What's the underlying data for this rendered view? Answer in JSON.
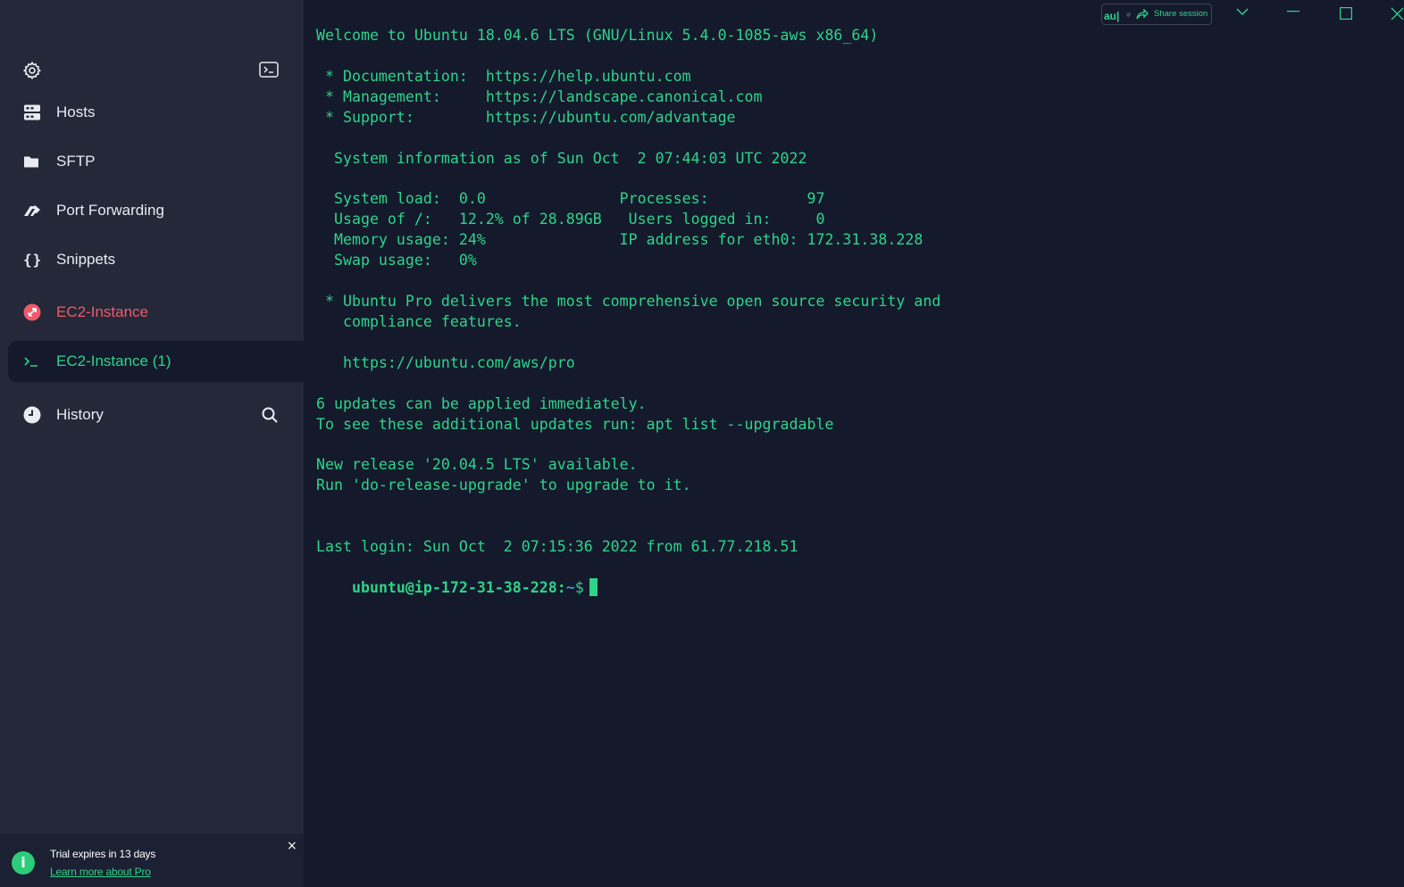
{
  "colors": {
    "accent_green": "#2fd38a",
    "danger_red": "#f0596a",
    "sidebar_bg": "#242838",
    "terminal_bg": "#141a2c",
    "path_blue": "#3c8fd6"
  },
  "sidebar": {
    "top_icons": [
      "gear-icon",
      "terminal-icon"
    ],
    "nav": [
      {
        "label": "Hosts",
        "icon": "server-icon"
      },
      {
        "label": "SFTP",
        "icon": "folder-icon"
      },
      {
        "label": "Port Forwarding",
        "icon": "port-forwarding-icon"
      },
      {
        "label": "Snippets",
        "icon": "braces-icon"
      },
      {
        "label": "EC2-Instance",
        "icon": "host-error-icon",
        "status": "error"
      },
      {
        "label": "EC2-Instance (1)",
        "icon": "prompt-icon",
        "active": true
      },
      {
        "label": "History",
        "icon": "clock-icon",
        "action_icon": "search-icon"
      }
    ],
    "trial": {
      "text": "Trial expires in 13 days",
      "link": "Learn more about Pro",
      "close": "×",
      "icon_text": "i"
    }
  },
  "header": {
    "badge": "au|",
    "share_label": "Share session",
    "icons": [
      "dot-icon",
      "share-arrow-icon",
      "chevron-down-icon",
      "minimize-icon",
      "maximize-icon",
      "close-icon"
    ]
  },
  "terminal": {
    "output": "Welcome to Ubuntu 18.04.6 LTS (GNU/Linux 5.4.0-1085-aws x86_64)\n\n * Documentation:  https://help.ubuntu.com\n * Management:     https://landscape.canonical.com\n * Support:        https://ubuntu.com/advantage\n\n  System information as of Sun Oct  2 07:44:03 UTC 2022\n\n  System load:  0.0               Processes:           97\n  Usage of /:   12.2% of 28.89GB   Users logged in:     0\n  Memory usage: 24%               IP address for eth0: 172.31.38.228\n  Swap usage:   0%\n\n * Ubuntu Pro delivers the most comprehensive open source security and\n   compliance features.\n\n   https://ubuntu.com/aws/pro\n\n6 updates can be applied immediately.\nTo see these additional updates run: apt list --upgradable\n\nNew release '20.04.5 LTS' available.\nRun 'do-release-upgrade' to upgrade to it.\n\n\nLast login: Sun Oct  2 07:15:36 2022 from 61.77.218.51",
    "prompt_user": "ubuntu@ip-172-31-38-228:",
    "prompt_path": "~",
    "prompt_symbol": "$"
  }
}
